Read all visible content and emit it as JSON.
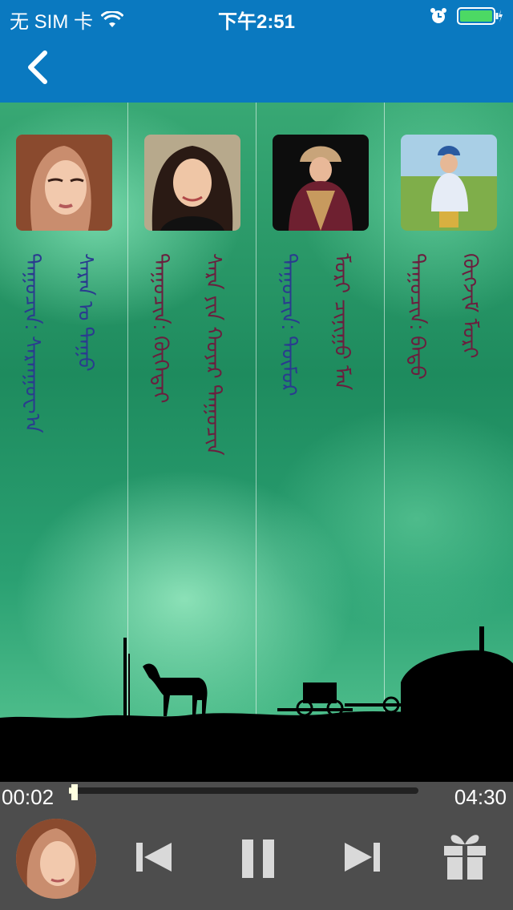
{
  "status_bar": {
    "carrier": "无 SIM 卡",
    "time": "下午2:51"
  },
  "nav": {
    "back_icon": "chevron-left-icon"
  },
  "theme": {
    "accent": "#0a79c0",
    "text_label": "#2a3b8f",
    "text_value": "#6b1e3e",
    "player_bg": "#4d4d4d"
  },
  "columns": [
    {
      "text_a": "ᠳᠠᠭᠤᠴᠢᠨ: ᠰᠠᠷᠠᠨᠭᠤᠸ᠎ᠠ",
      "text_b": "ᠰᠠᠷᠠᠨ ᠤ ᠳᠠᠭᠤ",
      "text_a_color": "#2a3b8f",
      "text_b_color": "#2a3b8f"
    },
    {
      "text_a": "ᠳᠠᠭᠤᠴᠢᠨ: ᠬᠥᠬᠡᠳᠡᠢ",
      "text_b": "ᠰᠠᠷᠠ ᠶᠢᠨ ᠬᠣᠶᠠᠷ ᠳᠠᠭᠤᠴᠢᠨ",
      "text_a_color": "#6b1e3e",
      "text_b_color": "#6b1e3e"
    },
    {
      "text_a": "ᠳᠠᠭᠤᠴᠢᠨ: ᠲᠥᠮᠦᠷ",
      "text_b": "ᠮᠣᠷᠢ ᠴᠢᠨᠢᠭᠤ ᠮᠡᠨ",
      "text_a_color": "#2a3b8f",
      "text_b_color": "#6b1e3e"
    },
    {
      "text_a": "ᠳᠠᠭᠤᠴᠢᠨ: ᠪᠠᠲᠤ",
      "text_b": "ᠬᠦᠭᠵᠢᠮ ᠮᠣᠷᠢ",
      "text_a_color": "#6b1e3e",
      "text_b_color": "#6b1e3e"
    }
  ],
  "player": {
    "current_time": "00:02",
    "total_time": "04:30",
    "progress_fraction": 0.008,
    "buttons": {
      "prev": "skip-back-icon",
      "pause": "pause-icon",
      "next": "skip-forward-icon",
      "gift": "gift-icon"
    }
  }
}
